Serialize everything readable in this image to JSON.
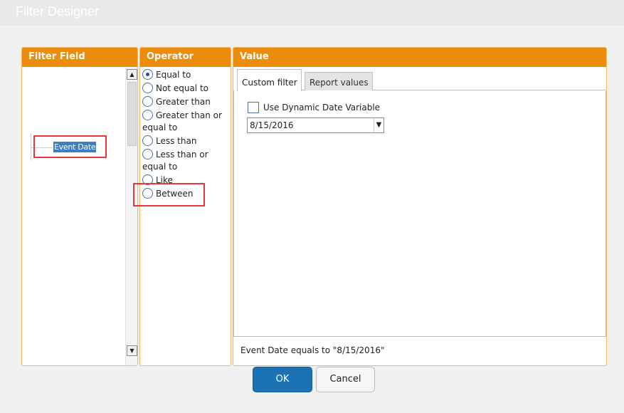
{
  "window": {
    "title": "Filter Designer"
  },
  "field_panel": {
    "header": "Filter Field",
    "tree": [
      {
        "label": "Event Date",
        "selected": true
      }
    ]
  },
  "operator_panel": {
    "header": "Operator",
    "options": [
      {
        "label": "Equal to",
        "checked": true
      },
      {
        "label": "Not equal to",
        "checked": false
      },
      {
        "label": "Greater than",
        "checked": false
      },
      {
        "label": "Greater than or equal to",
        "checked": false
      },
      {
        "label": "Less than",
        "checked": false
      },
      {
        "label": "Less than or equal to",
        "checked": false
      },
      {
        "label": "Like",
        "checked": false
      },
      {
        "label": "Between",
        "checked": false
      }
    ]
  },
  "value_panel": {
    "header": "Value",
    "tabs": [
      {
        "label": "Custom filter",
        "active": true
      },
      {
        "label": "Report values",
        "active": false
      }
    ],
    "dynamic_date_label": "Use Dynamic Date Variable",
    "dynamic_date_checked": false,
    "date_value": "8/15/2016",
    "summary": "Event Date equals to \"8/15/2016\""
  },
  "buttons": {
    "ok": "OK",
    "cancel": "Cancel"
  },
  "colors": {
    "header_orange": "#ec8c0d",
    "ok_blue": "#1b73b6",
    "selection_blue": "#3d7fc1",
    "highlight_red": "#e3393c"
  }
}
